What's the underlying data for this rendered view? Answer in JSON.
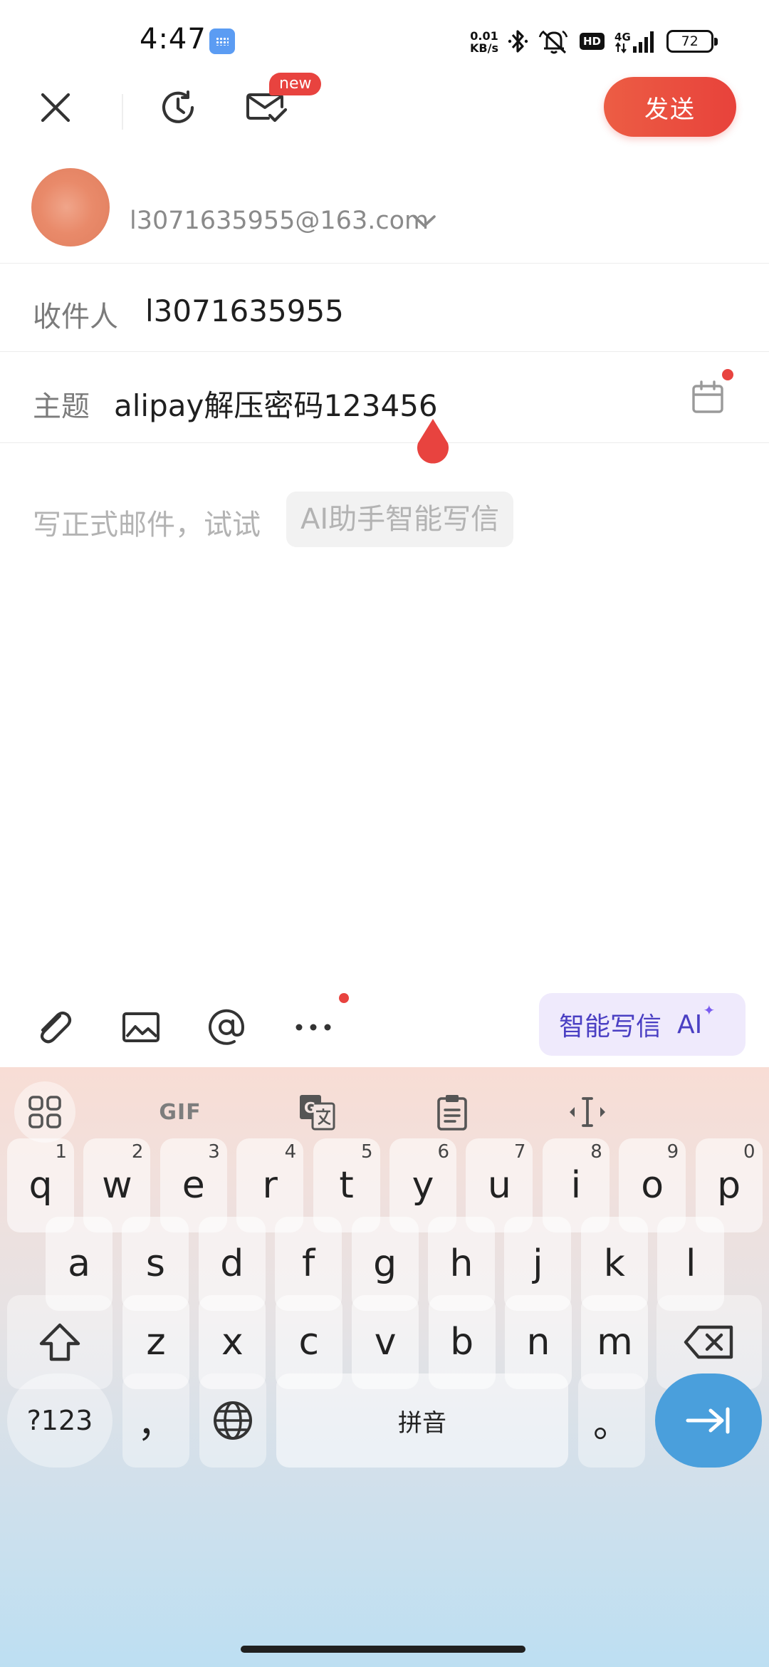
{
  "status_bar": {
    "time": "4:47",
    "net_speed_value": "0.01",
    "net_speed_unit": "KB/s",
    "hd": "HD",
    "network": "4G",
    "battery": "72"
  },
  "toolbar": {
    "new_badge": "new",
    "send_label": "发送"
  },
  "sender": {
    "email": "l3071635955@163.com"
  },
  "to_field": {
    "label": "收件人",
    "value": "l3071635955"
  },
  "subject_field": {
    "label": "主题",
    "value": "alipay解压密码123456"
  },
  "body": {
    "placeholder": "写正式邮件，试试",
    "ai_chip": "AI助手智能写信"
  },
  "compose_actions": {
    "ai_write_label": "智能写信",
    "ai_write_ai": "AI",
    "ai_spark": "✦"
  },
  "keyboard": {
    "gif_label": "GIF",
    "row1": [
      {
        "key": "q",
        "hint": "1"
      },
      {
        "key": "w",
        "hint": "2"
      },
      {
        "key": "e",
        "hint": "3"
      },
      {
        "key": "r",
        "hint": "4"
      },
      {
        "key": "t",
        "hint": "5"
      },
      {
        "key": "y",
        "hint": "6"
      },
      {
        "key": "u",
        "hint": "7"
      },
      {
        "key": "i",
        "hint": "8"
      },
      {
        "key": "o",
        "hint": "9"
      },
      {
        "key": "p",
        "hint": "0"
      }
    ],
    "row2": [
      "a",
      "s",
      "d",
      "f",
      "g",
      "h",
      "j",
      "k",
      "l"
    ],
    "row3": [
      "z",
      "x",
      "c",
      "v",
      "b",
      "n",
      "m"
    ],
    "sym_label": "?123",
    "comma": "，",
    "space_label": "拼音",
    "period": "。"
  },
  "colors": {
    "accent_red": "#e8433f",
    "ai_purple": "#4a3fc3",
    "enter_blue": "#4a9fdc"
  }
}
